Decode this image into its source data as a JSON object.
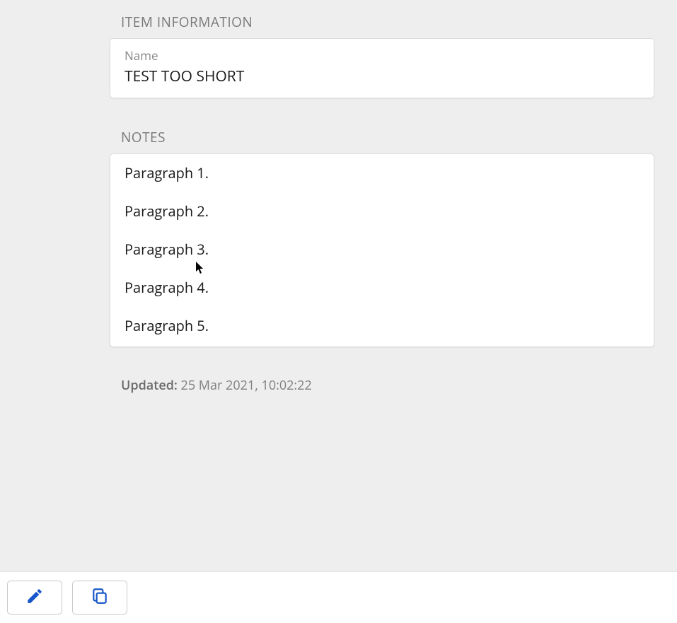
{
  "section_item_info_title": "ITEM INFORMATION",
  "name_field": {
    "label": "Name",
    "value": "TEST TOO SHORT"
  },
  "section_notes_title": "NOTES",
  "notes": [
    "Paragraph 1.",
    "Paragraph 2.",
    "Paragraph 3.",
    "Paragraph 4.",
    "Paragraph 5."
  ],
  "updated": {
    "label": "Updated:",
    "value": "25 Mar 2021, 10:02:22"
  },
  "toolbar": {
    "edit_icon": "pencil-icon",
    "copy_icon": "copy-icon"
  }
}
